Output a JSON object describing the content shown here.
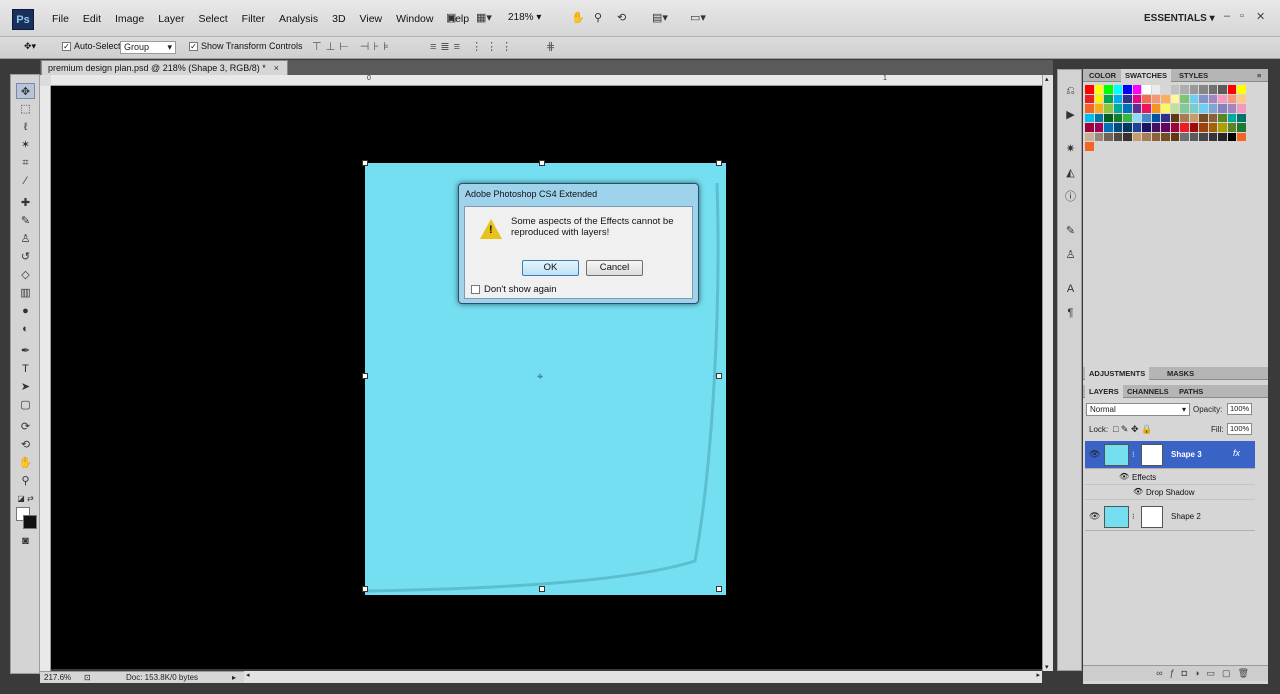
{
  "app": {
    "logo": "Ps",
    "menu": [
      "File",
      "Edit",
      "Image",
      "Layer",
      "Select",
      "Filter",
      "Analysis",
      "3D",
      "View",
      "Window",
      "Help"
    ],
    "zoom": "218%",
    "workspace": "ESSENTIALS"
  },
  "options": {
    "auto_select_label": "Auto-Select:",
    "auto_select_value": "Group",
    "transform_label": "Show Transform Controls"
  },
  "document": {
    "tab_title": "premium design plan.psd @ 218% (Shape 3, RGB/8) *",
    "tab_close": "×",
    "ruler_marks": [
      "0",
      "1"
    ],
    "status_zoom": "217.6%",
    "status_doc": "Doc: 153.8K/0 bytes",
    "shape_color": "#74dff1"
  },
  "dialog": {
    "title": "Adobe Photoshop CS4 Extended",
    "message": "Some aspects of the Effects cannot be reproduced with layers!",
    "ok": "OK",
    "cancel": "Cancel",
    "dont_show": "Don't show again",
    "warning_mark": "!"
  },
  "panels": {
    "top_tabs": [
      "COLOR",
      "SWATCHES",
      "STYLES"
    ],
    "mid_tabs": [
      "ADJUSTMENTS",
      "MASKS"
    ],
    "layer_tabs": [
      "LAYERS",
      "CHANNELS",
      "PATHS"
    ],
    "blend_mode": "Normal",
    "opacity_label": "Opacity:",
    "opacity": "100%",
    "lock_label": "Lock:",
    "fill_label": "Fill:",
    "fill": "100%",
    "layers": [
      {
        "name": "Shape 3",
        "fx": "fx"
      },
      {
        "name": "Shape 2"
      }
    ],
    "effects_label": "Effects",
    "drop_shadow_label": "Drop Shadow"
  }
}
